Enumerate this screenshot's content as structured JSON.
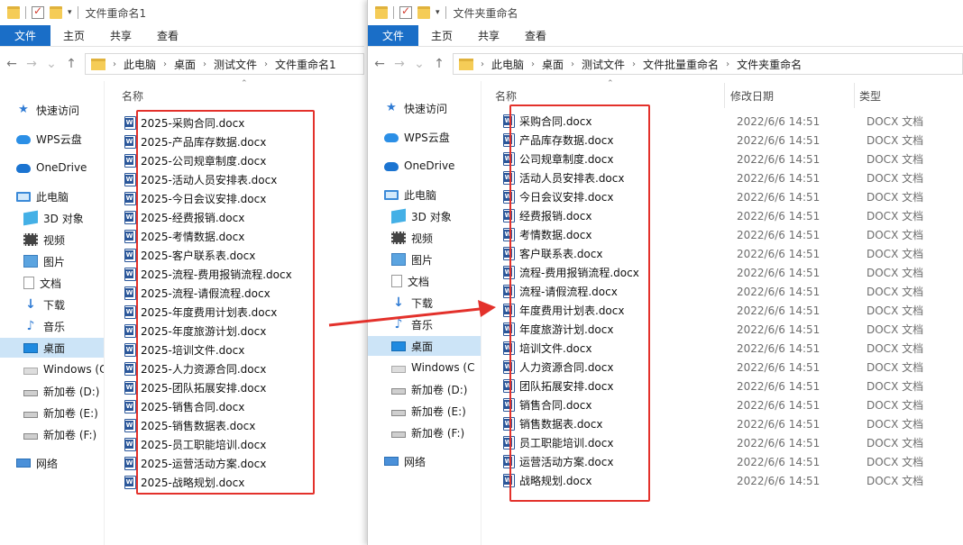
{
  "left": {
    "title": "文件重命名1",
    "ribbon": [
      "文件",
      "主页",
      "共享",
      "查看"
    ],
    "breadcrumb": [
      "此电脑",
      "桌面",
      "测试文件",
      "文件重命名1"
    ],
    "column_name": "名称",
    "nav": [
      {
        "label": "快速访问",
        "icon": "quick-access-star-icon",
        "cls": "ic-star",
        "glyph": "★"
      },
      {
        "label": "WPS云盘",
        "icon": "wps-cloud-icon",
        "cls": "ic-cloud"
      },
      {
        "label": "OneDrive",
        "icon": "onedrive-cloud-icon",
        "cls": "ic-onedrive"
      },
      {
        "label": "此电脑",
        "icon": "this-pc-icon",
        "cls": "ic-pc"
      },
      {
        "label": "3D 对象",
        "icon": "3d-objects-icon",
        "cls": "ic-3d"
      },
      {
        "label": "视频",
        "icon": "videos-icon",
        "cls": "ic-video"
      },
      {
        "label": "图片",
        "icon": "pictures-icon",
        "cls": "ic-pic"
      },
      {
        "label": "文档",
        "icon": "documents-icon",
        "cls": "ic-doc"
      },
      {
        "label": "下载",
        "icon": "downloads-icon",
        "cls": "ic-dl",
        "glyph": "↓"
      },
      {
        "label": "音乐",
        "icon": "music-icon",
        "cls": "ic-music",
        "glyph": "♪"
      },
      {
        "label": "桌面",
        "icon": "desktop-icon",
        "cls": "ic-desk",
        "selected": true
      },
      {
        "label": "Windows (C",
        "icon": "windows-drive-icon",
        "cls": "ic-win"
      },
      {
        "label": "新加卷 (D:)",
        "icon": "drive-icon",
        "cls": "ic-drive"
      },
      {
        "label": "新加卷 (E:)",
        "icon": "drive-icon",
        "cls": "ic-drive"
      },
      {
        "label": "新加卷 (F:)",
        "icon": "drive-icon",
        "cls": "ic-drive"
      },
      {
        "label": "网络",
        "icon": "network-icon",
        "cls": "ic-net"
      }
    ],
    "files": [
      "2025-采购合同.docx",
      "2025-产品库存数据.docx",
      "2025-公司规章制度.docx",
      "2025-活动人员安排表.docx",
      "2025-今日会议安排.docx",
      "2025-经费报销.docx",
      "2025-考情数据.docx",
      "2025-客户联系表.docx",
      "2025-流程-费用报销流程.docx",
      "2025-流程-请假流程.docx",
      "2025-年度费用计划表.docx",
      "2025-年度旅游计划.docx",
      "2025-培训文件.docx",
      "2025-人力资源合同.docx",
      "2025-团队拓展安排.docx",
      "2025-销售合同.docx",
      "2025-销售数据表.docx",
      "2025-员工职能培训.docx",
      "2025-运营活动方案.docx",
      "2025-战略规划.docx"
    ]
  },
  "right": {
    "title": "文件夹重命名",
    "ribbon": [
      "文件",
      "主页",
      "共享",
      "查看"
    ],
    "breadcrumb": [
      "此电脑",
      "桌面",
      "测试文件",
      "文件批量重命名",
      "文件夹重命名"
    ],
    "column_name": "名称",
    "column_date": "修改日期",
    "column_type": "类型",
    "nav": [
      {
        "label": "快速访问",
        "icon": "quick-access-star-icon",
        "cls": "ic-star",
        "glyph": "★"
      },
      {
        "label": "WPS云盘",
        "icon": "wps-cloud-icon",
        "cls": "ic-cloud"
      },
      {
        "label": "OneDrive",
        "icon": "onedrive-cloud-icon",
        "cls": "ic-onedrive"
      },
      {
        "label": "此电脑",
        "icon": "this-pc-icon",
        "cls": "ic-pc"
      },
      {
        "label": "3D 对象",
        "icon": "3d-objects-icon",
        "cls": "ic-3d"
      },
      {
        "label": "视频",
        "icon": "videos-icon",
        "cls": "ic-video"
      },
      {
        "label": "图片",
        "icon": "pictures-icon",
        "cls": "ic-pic"
      },
      {
        "label": "文档",
        "icon": "documents-icon",
        "cls": "ic-doc"
      },
      {
        "label": "下载",
        "icon": "downloads-icon",
        "cls": "ic-dl",
        "glyph": "↓"
      },
      {
        "label": "音乐",
        "icon": "music-icon",
        "cls": "ic-music",
        "glyph": "♪"
      },
      {
        "label": "桌面",
        "icon": "desktop-icon",
        "cls": "ic-desk",
        "selected": true
      },
      {
        "label": "Windows (C",
        "icon": "windows-drive-icon",
        "cls": "ic-win"
      },
      {
        "label": "新加卷 (D:)",
        "icon": "drive-icon",
        "cls": "ic-drive"
      },
      {
        "label": "新加卷 (E:)",
        "icon": "drive-icon",
        "cls": "ic-drive"
      },
      {
        "label": "新加卷 (F:)",
        "icon": "drive-icon",
        "cls": "ic-drive"
      },
      {
        "label": "网络",
        "icon": "network-icon",
        "cls": "ic-net"
      }
    ],
    "files": [
      {
        "name": "采购合同.docx",
        "date": "2022/6/6 14:51",
        "type": "DOCX 文档"
      },
      {
        "name": "产品库存数据.docx",
        "date": "2022/6/6 14:51",
        "type": "DOCX 文档"
      },
      {
        "name": "公司规章制度.docx",
        "date": "2022/6/6 14:51",
        "type": "DOCX 文档"
      },
      {
        "name": "活动人员安排表.docx",
        "date": "2022/6/6 14:51",
        "type": "DOCX 文档"
      },
      {
        "name": "今日会议安排.docx",
        "date": "2022/6/6 14:51",
        "type": "DOCX 文档"
      },
      {
        "name": "经费报销.docx",
        "date": "2022/6/6 14:51",
        "type": "DOCX 文档"
      },
      {
        "name": "考情数据.docx",
        "date": "2022/6/6 14:51",
        "type": "DOCX 文档"
      },
      {
        "name": "客户联系表.docx",
        "date": "2022/6/6 14:51",
        "type": "DOCX 文档"
      },
      {
        "name": "流程-费用报销流程.docx",
        "date": "2022/6/6 14:51",
        "type": "DOCX 文档"
      },
      {
        "name": "流程-请假流程.docx",
        "date": "2022/6/6 14:51",
        "type": "DOCX 文档"
      },
      {
        "name": "年度费用计划表.docx",
        "date": "2022/6/6 14:51",
        "type": "DOCX 文档"
      },
      {
        "name": "年度旅游计划.docx",
        "date": "2022/6/6 14:51",
        "type": "DOCX 文档"
      },
      {
        "name": "培训文件.docx",
        "date": "2022/6/6 14:51",
        "type": "DOCX 文档"
      },
      {
        "name": "人力资源合同.docx",
        "date": "2022/6/6 14:51",
        "type": "DOCX 文档"
      },
      {
        "name": "团队拓展安排.docx",
        "date": "2022/6/6 14:51",
        "type": "DOCX 文档"
      },
      {
        "name": "销售合同.docx",
        "date": "2022/6/6 14:51",
        "type": "DOCX 文档"
      },
      {
        "name": "销售数据表.docx",
        "date": "2022/6/6 14:51",
        "type": "DOCX 文档"
      },
      {
        "name": "员工职能培训.docx",
        "date": "2022/6/6 14:51",
        "type": "DOCX 文档"
      },
      {
        "name": "运营活动方案.docx",
        "date": "2022/6/6 14:51",
        "type": "DOCX 文档"
      },
      {
        "name": "战略规划.docx",
        "date": "2022/6/6 14:51",
        "type": "DOCX 文档"
      }
    ]
  },
  "colors": {
    "file_tab": "#1a6ec7",
    "selected_nav": "#cce4f7",
    "highlight": "#e3312b",
    "word_icon": "#2b579a"
  }
}
